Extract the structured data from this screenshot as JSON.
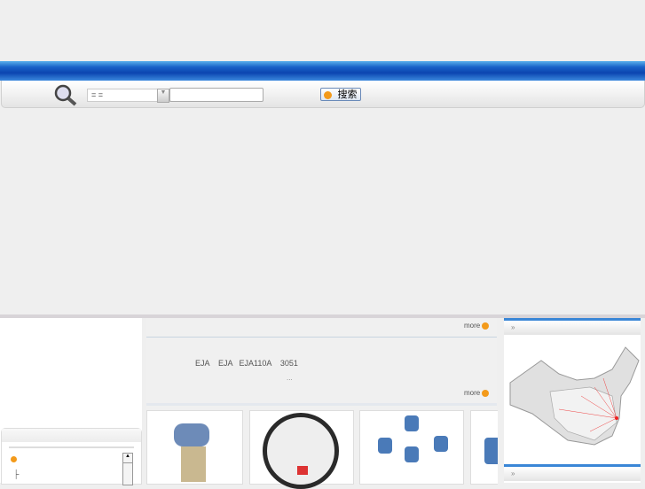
{
  "search": {
    "category_value": "=  =",
    "keyword_value": "",
    "button_label": "搜索"
  },
  "news": {
    "more_label": "more",
    "line1": "EJA    EJA   EJA110A    3051",
    "ellipsis": "...",
    "more2_label": "more"
  },
  "sidebar": {
    "tree_item": "├"
  },
  "right": {
    "map_header_icon": "»",
    "bottom_header_icon": "»"
  },
  "colors": {
    "accent_blue": "#0b45b0",
    "orange": "#f39a1a"
  }
}
